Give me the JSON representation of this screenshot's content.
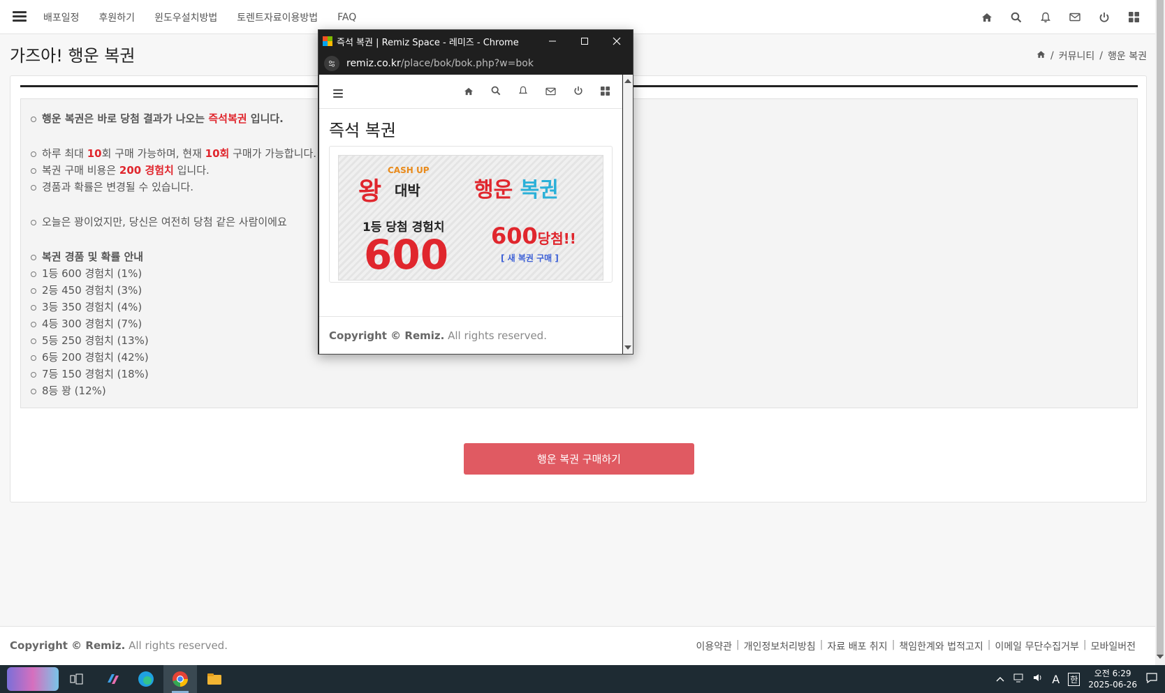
{
  "topnav": {
    "menu_icon": "hamburger-icon",
    "links": [
      "배포일정",
      "후원하기",
      "윈도우설치방법",
      "토렌트자료이용방법",
      "FAQ"
    ],
    "icons": [
      "home-icon",
      "search-icon",
      "bell-icon",
      "mail-icon",
      "power-icon",
      "grid-icon"
    ]
  },
  "page": {
    "title": "가즈아! 행운 복권",
    "breadcrumb": [
      "커뮤니티",
      "행운 복권"
    ],
    "breadcrumb_sep": "/"
  },
  "info": {
    "line1_a": "행운 복권은 바로 당첨 결과가 나오는 ",
    "line1_b": "즉석복권",
    "line1_c": " 입니다.",
    "line2_a": "하루 최대 ",
    "line2_b": "10",
    "line2_c": "회 구매 가능하며, 현재 ",
    "line2_d": "10회",
    "line2_e": " 구매가 가능합니다.",
    "line3_a": "복권 구매 비용은 ",
    "line3_b": "200 경험치",
    "line3_c": " 입니다.",
    "line4": "경품과 확률은 변경될 수 있습니다.",
    "line5": "오늘은 꽝이었지만, 당신은 여전히 당첨 같은 사람이에요",
    "prize_header": "복권 경품 및 확률 안내",
    "prizes": [
      "1등 600 경험치 (1%)",
      "2등 450 경험치 (3%)",
      "3등 350 경험치 (4%)",
      "4등 300 경험치 (7%)",
      "5등 250 경험치 (13%)",
      "6등 200 경험치 (42%)",
      "7등 150 경험치 (18%)",
      "8등 꽝 (12%)"
    ]
  },
  "buy_button": "행운 복권 구매하기",
  "footer": {
    "copy_bold": "Copyright © Remiz.",
    "copy_rest": " All rights reserved.",
    "links": [
      "이용약관",
      "개인정보처리방침",
      "자료 배포 취지",
      "책임한계와 법적고지",
      "이메일 무단수집거부",
      "모바일버전"
    ]
  },
  "popup": {
    "window_title": "즉석 복권 | Remiz Space - 레미즈 - Chrome",
    "url_domain": "remiz.co.kr",
    "url_path": "/place/bok/bok.php?w=bok",
    "page_title": "즉석 복권",
    "ticket": {
      "brand": "왕",
      "brand_small": "CASH UP",
      "brand_sub": "대박",
      "headline_a": "행운",
      "headline_b": "복권",
      "first_prize_label": "1등 당첨 경험치",
      "first_prize_value": "600",
      "result_value": "600",
      "result_text": "당첨!!",
      "new_buy": "[ 새 복권 구매 ]"
    },
    "footer_bold": "Copyright © Remiz.",
    "footer_rest": " All rights reserved."
  },
  "taskbar": {
    "clock_ampm_time": "오전 6:29",
    "clock_date": "2025-06-26",
    "ime": "A",
    "ime2": "한"
  },
  "colors": {
    "accent_red": "#e0262d",
    "button": "#e05a62",
    "link_blue": "#3b5fd6"
  }
}
